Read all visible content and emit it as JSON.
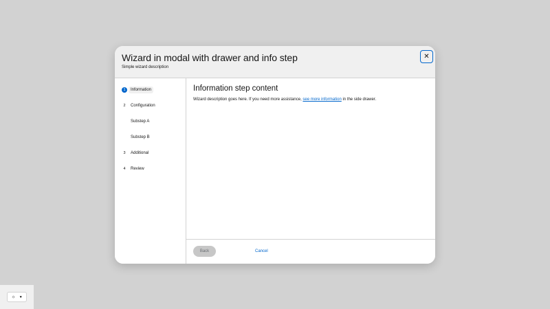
{
  "modal": {
    "title": "Wizard in modal with drawer and info step",
    "description": "Simple wizard description",
    "close_glyph": "✕"
  },
  "nav": {
    "steps": [
      {
        "number": "1",
        "label": "Information",
        "current": true
      },
      {
        "number": "2",
        "label": "Configuration",
        "current": false
      },
      {
        "number": "",
        "label": "Substep A",
        "substep": true
      },
      {
        "number": "",
        "label": "Substep B",
        "substep": true
      },
      {
        "number": "3",
        "label": "Additional",
        "current": false
      },
      {
        "number": "4",
        "label": "Review",
        "current": false
      }
    ]
  },
  "content": {
    "title": "Information step content",
    "text_before": "Wizard description goes here. If you need more assistance, ",
    "link_text": "see more information",
    "text_after": " in the side drawer."
  },
  "footer": {
    "back_label": "Back",
    "cancel_label": "Cancel"
  },
  "theme_switcher": {
    "icon": "sun-icon",
    "icon_glyph": "☼",
    "caret_glyph": "▼"
  },
  "colors": {
    "accent": "#0066cc",
    "backdrop": "#d2d2d2",
    "header_bg": "#f0f0f0"
  }
}
